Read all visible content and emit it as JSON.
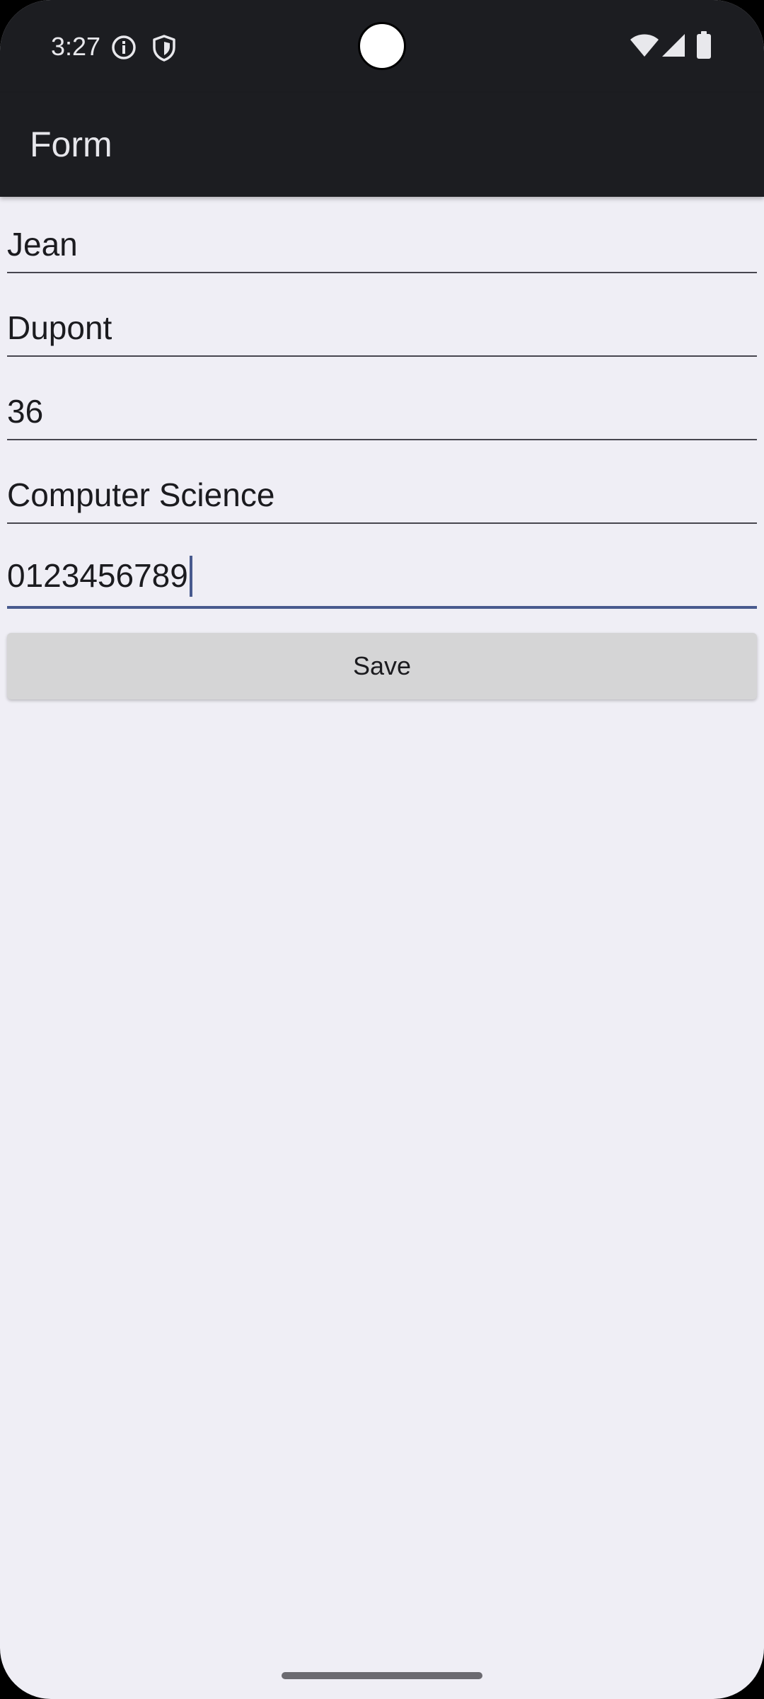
{
  "status_bar": {
    "time": "3:27",
    "left_icons": [
      "info-icon",
      "shield-icon"
    ],
    "right_icons": [
      "wifi-icon",
      "cellular-signal-icon",
      "battery-icon"
    ]
  },
  "app_bar": {
    "title": "Form"
  },
  "form": {
    "first_name": "Jean",
    "last_name": "Dupont",
    "age": "36",
    "field_of_study": "Computer Science",
    "phone": "0123456789"
  },
  "actions": {
    "save_label": "Save"
  },
  "colors": {
    "app_bar_bg": "#1C1D21",
    "screen_bg": "#EFEEF5",
    "focus_accent": "#485A8E",
    "button_bg": "#D5D5D6"
  }
}
